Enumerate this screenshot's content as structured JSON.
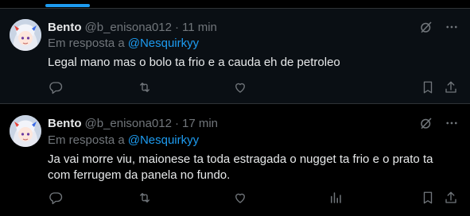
{
  "tweets": [
    {
      "name": "Bento",
      "handle": "@b_enisona012",
      "separator": "·",
      "time": "11 min",
      "reply_prefix": "Em resposta a",
      "reply_to": "@Nesquirkyy",
      "text": "Legal mano mas o bolo ta frio e a cauda eh de petroleo"
    },
    {
      "name": "Bento",
      "handle": "@b_enisona012",
      "separator": "·",
      "time": "17 min",
      "reply_prefix": "Em resposta a",
      "reply_to": "@Nesquirkyy",
      "text": "Ja vai morre viu, maionese ta toda estragada o nugget ta frio e o prato ta com ferrugem da panela no fundo."
    }
  ],
  "icons": {
    "grok": "grok-icon",
    "more": "more-icon",
    "reply": "reply-icon",
    "retweet": "retweet-icon",
    "like": "like-icon",
    "views": "views-icon",
    "bookmark": "bookmark-icon",
    "share": "share-icon"
  },
  "colors": {
    "background": "#000000",
    "highlighted_row": "#0a0f14",
    "text": "#e7e9ea",
    "muted": "#71767b",
    "accent": "#1d9bf0",
    "divider": "#2f3336"
  }
}
